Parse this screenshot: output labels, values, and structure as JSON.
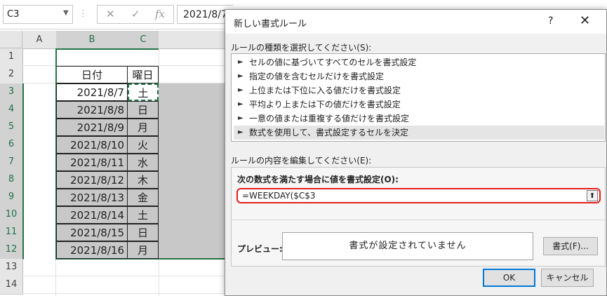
{
  "formula_bar": {
    "name_box": "C3",
    "name_box_arrow": "▼",
    "separator": "⋮",
    "cancel_symbol": "✕",
    "enter_symbol": "✓",
    "fx_symbol": "fx",
    "formula": "2021/8/7"
  },
  "grid": {
    "columns": [
      "A",
      "B",
      "C"
    ],
    "rows": [
      "1",
      "2",
      "3",
      "4",
      "5",
      "6",
      "7",
      "8",
      "9",
      "10",
      "11",
      "12",
      "13",
      "14"
    ],
    "header_date": "日付",
    "header_weekday": "曜日",
    "data": [
      {
        "date": "2021/8/7",
        "weekday": "土"
      },
      {
        "date": "2021/8/8",
        "weekday": "日"
      },
      {
        "date": "2021/8/9",
        "weekday": "月"
      },
      {
        "date": "2021/8/10",
        "weekday": "火"
      },
      {
        "date": "2021/8/11",
        "weekday": "水"
      },
      {
        "date": "2021/8/12",
        "weekday": "木"
      },
      {
        "date": "2021/8/13",
        "weekday": "金"
      },
      {
        "date": "2021/8/14",
        "weekday": "土"
      },
      {
        "date": "2021/8/15",
        "weekday": "日"
      },
      {
        "date": "2021/8/16",
        "weekday": "月"
      }
    ]
  },
  "dialog": {
    "title": "新しい書式ルール",
    "help": "?",
    "close": "✕",
    "rule_type_label": "ルールの種類を選択してください(S):",
    "rule_types": [
      "セルの値に基づいてすべてのセルを書式設定",
      "指定の値を含むセルだけを書式設定",
      "上位または下位に入る値だけを書式設定",
      "平均より上または下の値だけを書式設定",
      "一意の値または重複する値だけを書式設定",
      "数式を使用して、書式設定するセルを決定"
    ],
    "rule_arrow": "►",
    "edit_label": "ルールの内容を編集してください(E):",
    "condition_label": "次の数式を満たす場合に値を書式設定(O):",
    "formula": "=WEEKDAY($C$3",
    "collapse_symbol": "⬆",
    "preview_label": "プレビュー:",
    "preview_text": "書式が設定されていません",
    "format_button": "書式(F)...",
    "ok_button": "OK",
    "cancel_button": "キャンセル"
  }
}
